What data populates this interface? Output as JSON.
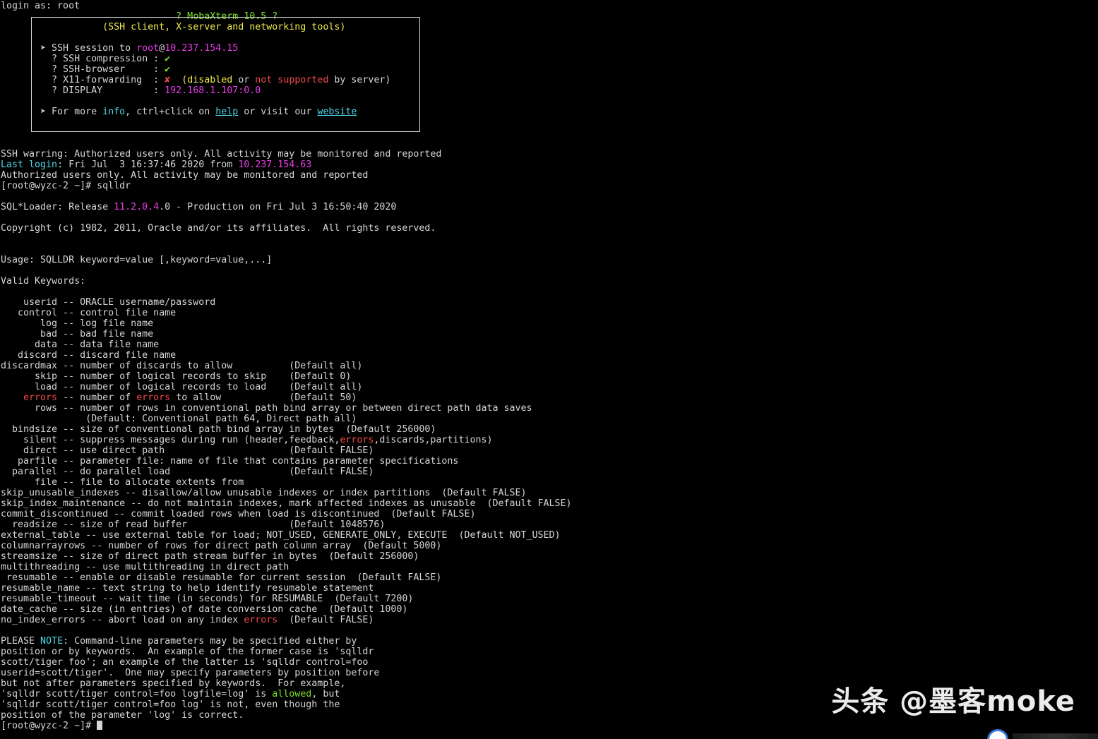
{
  "terminal": {
    "lines": [
      [
        {
          "t": "login as: root",
          "c": "def"
        }
      ],
      [
        {
          "t": "                               ",
          "c": "def"
        },
        {
          "t": "? MobaXterm 10.5 ?",
          "c": "green"
        }
      ],
      [
        {
          "t": "                  ",
          "c": "def"
        },
        {
          "t": "(SSH client, X-server and networking tools)",
          "c": "yellow"
        }
      ],
      [],
      [
        {
          "t": "       ➤ SSH session to ",
          "c": "def"
        },
        {
          "t": "root",
          "c": "magenta"
        },
        {
          "t": "@",
          "c": "def"
        },
        {
          "t": "10.237.154.15",
          "c": "magenta"
        }
      ],
      [
        {
          "t": "         ? SSH compression : ",
          "c": "def"
        },
        {
          "t": "✔",
          "c": "green"
        }
      ],
      [
        {
          "t": "         ? SSH-browser     : ",
          "c": "def"
        },
        {
          "t": "✔",
          "c": "green"
        }
      ],
      [
        {
          "t": "         ? X11-forwarding  : ",
          "c": "def"
        },
        {
          "t": "✘",
          "c": "red"
        },
        {
          "t": "  ",
          "c": "def"
        },
        {
          "t": "(disabled ",
          "c": "yellow"
        },
        {
          "t": "or",
          "c": "def"
        },
        {
          "t": " not supported",
          "c": "red"
        },
        {
          "t": " by server)",
          "c": "def"
        }
      ],
      [
        {
          "t": "         ? DISPLAY         : ",
          "c": "def"
        },
        {
          "t": "192.168.1.107:0.0",
          "c": "magenta"
        }
      ],
      [],
      [
        {
          "t": "       ➤ For more ",
          "c": "def"
        },
        {
          "t": "info",
          "c": "cyan"
        },
        {
          "t": ", ctrl+click on ",
          "c": "def"
        },
        {
          "t": "help",
          "c": "cyan",
          "u": true
        },
        {
          "t": " or visit our ",
          "c": "def"
        },
        {
          "t": "website",
          "c": "cyan",
          "u": true
        }
      ],
      [],
      [],
      [],
      [
        {
          "t": "SSH warring: Authorized users only. All activity may be monitored and reported",
          "c": "def"
        }
      ],
      [
        {
          "t": "Last login",
          "c": "cyan"
        },
        {
          "t": ": Fri Jul  3 16:37:46 2020 from ",
          "c": "def"
        },
        {
          "t": "10.237.154.63",
          "c": "magenta"
        }
      ],
      [
        {
          "t": "Authorized users only. All activity may be monitored and reported",
          "c": "def"
        }
      ],
      [
        {
          "t": "[root@wyzc-2 ~]# sqlldr",
          "c": "def"
        }
      ],
      [],
      [
        {
          "t": "SQL*Loader: Release ",
          "c": "def"
        },
        {
          "t": "11.2.0.4",
          "c": "magenta"
        },
        {
          "t": ".0 - Production on Fri Jul 3 16:50:40 2020",
          "c": "def"
        }
      ],
      [],
      [
        {
          "t": "Copyright (c) 1982, 2011, Oracle and/or its affiliates.  All rights reserved.",
          "c": "def"
        }
      ],
      [],
      [],
      [
        {
          "t": "Usage: SQLLDR keyword=value [,keyword=value,...]",
          "c": "def"
        }
      ],
      [],
      [
        {
          "t": "Valid Keywords:",
          "c": "def"
        }
      ],
      [],
      [
        {
          "t": "    userid -- ORACLE username/password",
          "c": "def"
        }
      ],
      [
        {
          "t": "   control -- control file name",
          "c": "def"
        }
      ],
      [
        {
          "t": "       log -- log file name",
          "c": "def"
        }
      ],
      [
        {
          "t": "       bad -- bad file name",
          "c": "def"
        }
      ],
      [
        {
          "t": "      data -- data file name",
          "c": "def"
        }
      ],
      [
        {
          "t": "   discard -- discard file name",
          "c": "def"
        }
      ],
      [
        {
          "t": "discardmax -- number of discards to allow          (Default all)",
          "c": "def"
        }
      ],
      [
        {
          "t": "      skip -- number of logical records to skip    (Default 0)",
          "c": "def"
        }
      ],
      [
        {
          "t": "      load -- number of logical records to load    (Default all)",
          "c": "def"
        }
      ],
      [
        {
          "t": "    ",
          "c": "def"
        },
        {
          "t": "errors",
          "c": "red"
        },
        {
          "t": " -- number of ",
          "c": "def"
        },
        {
          "t": "errors",
          "c": "red"
        },
        {
          "t": " to allow            (Default 50)",
          "c": "def"
        }
      ],
      [
        {
          "t": "      rows -- number of rows in conventional path bind array or between direct path data saves",
          "c": "def"
        }
      ],
      [
        {
          "t": "               (Default: Conventional path 64, Direct path all)",
          "c": "def"
        }
      ],
      [
        {
          "t": "  bindsize -- size of conventional path bind array in bytes  (Default 256000)",
          "c": "def"
        }
      ],
      [
        {
          "t": "    silent -- suppress messages during run (header,feedback,",
          "c": "def"
        },
        {
          "t": "errors",
          "c": "red"
        },
        {
          "t": ",discards,partitions)",
          "c": "def"
        }
      ],
      [
        {
          "t": "    direct -- use direct path                      (Default FALSE)",
          "c": "def"
        }
      ],
      [
        {
          "t": "   parfile -- parameter file: name of file that contains parameter specifications",
          "c": "def"
        }
      ],
      [
        {
          "t": "  parallel -- do parallel load                     (Default FALSE)",
          "c": "def"
        }
      ],
      [
        {
          "t": "      file -- file to allocate extents from",
          "c": "def"
        }
      ],
      [
        {
          "t": "skip_unusable_indexes -- disallow/allow unusable indexes or index partitions  (Default FALSE)",
          "c": "def"
        }
      ],
      [
        {
          "t": "skip_index_maintenance -- do not maintain indexes, mark affected indexes as unusable  (Default FALSE)",
          "c": "def"
        }
      ],
      [
        {
          "t": "commit_discontinued -- commit loaded rows when load is discontinued  (Default FALSE)",
          "c": "def"
        }
      ],
      [
        {
          "t": "  readsize -- size of read buffer                  (Default 1048576)",
          "c": "def"
        }
      ],
      [
        {
          "t": "external_table -- use external table for load; NOT_USED, GENERATE_ONLY, EXECUTE  (Default NOT_USED)",
          "c": "def"
        }
      ],
      [
        {
          "t": "columnarrayrows -- number of rows for direct path column array  (Default 5000)",
          "c": "def"
        }
      ],
      [
        {
          "t": "streamsize -- size of direct path stream buffer in bytes  (Default 256000)",
          "c": "def"
        }
      ],
      [
        {
          "t": "multithreading -- use multithreading in direct path",
          "c": "def"
        }
      ],
      [
        {
          "t": " resumable -- enable or disable resumable for current session  (Default FALSE)",
          "c": "def"
        }
      ],
      [
        {
          "t": "resumable_name -- text string to help identify resumable statement",
          "c": "def"
        }
      ],
      [
        {
          "t": "resumable_timeout -- wait time (in seconds) for RESUMABLE  (Default 7200)",
          "c": "def"
        }
      ],
      [
        {
          "t": "date_cache -- size (in entries) of date conversion cache  (Default 1000)",
          "c": "def"
        }
      ],
      [
        {
          "t": "no_index_errors -- abort load on any index ",
          "c": "def"
        },
        {
          "t": "errors",
          "c": "red"
        },
        {
          "t": "  (Default FALSE)",
          "c": "def"
        }
      ],
      [],
      [
        {
          "t": "PLEASE ",
          "c": "def"
        },
        {
          "t": "NOTE",
          "c": "cyan"
        },
        {
          "t": ": Command-line parameters may be specified either by",
          "c": "def"
        }
      ],
      [
        {
          "t": "position or by keywords.  An example of the former case is 'sqlldr",
          "c": "def"
        }
      ],
      [
        {
          "t": "scott/tiger foo'; an example of the latter is 'sqlldr control=foo",
          "c": "def"
        }
      ],
      [
        {
          "t": "userid=scott/tiger'.  One may specify parameters by position before",
          "c": "def"
        }
      ],
      [
        {
          "t": "but not after parameters specified by keywords.  For example,",
          "c": "def"
        }
      ],
      [
        {
          "t": "'sqlldr scott/tiger control=foo logfile=log' is ",
          "c": "def"
        },
        {
          "t": "allowed",
          "c": "green"
        },
        {
          "t": ", but",
          "c": "def"
        }
      ],
      [
        {
          "t": "'sqlldr scott/tiger control=foo log' is not, even though the",
          "c": "def"
        }
      ],
      [
        {
          "t": "position of the parameter 'log' is correct.",
          "c": "def"
        }
      ],
      [
        {
          "t": "[root@wyzc-2 ~]# ",
          "c": "def"
        },
        {
          "cursor": true
        }
      ]
    ]
  },
  "watermark": {
    "text": "头条 @墨客moke"
  },
  "colors": {
    "background": "#000000",
    "foreground": "#d6d6d6",
    "green": "#7ae02a",
    "yellow": "#f0ec4c",
    "magenta": "#e63ce6",
    "red": "#f04a4a",
    "cyan": "#4ed8e8"
  },
  "icons": {
    "tray": "input-method-icon"
  }
}
